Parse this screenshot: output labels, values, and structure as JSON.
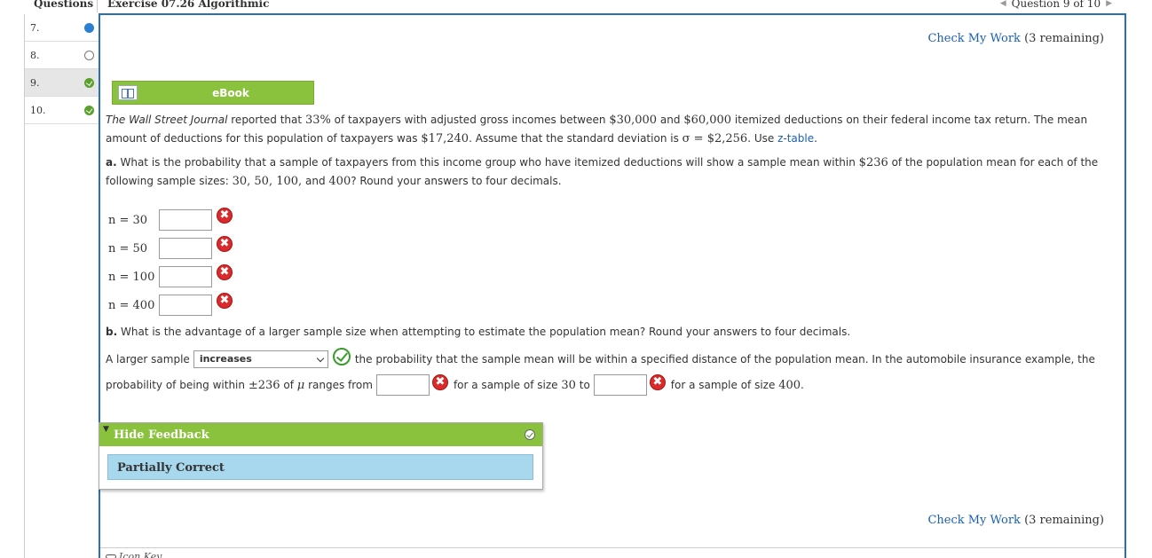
{
  "header": {
    "questions_label": "Questions",
    "exercise_title": "Exercise 07.26 Algorithmic",
    "question_position": "Question 9 of 10",
    "prev_icon": "triangle-left-icon",
    "next_icon": "triangle-right-icon"
  },
  "question_list": [
    {
      "number": "7.",
      "status": "in-progress"
    },
    {
      "number": "8.",
      "status": "not-started"
    },
    {
      "number": "9.",
      "status": "completed"
    },
    {
      "number": "10.",
      "status": "completed"
    }
  ],
  "check_my_work": {
    "label": "Check My Work",
    "remaining": "(3 remaining)"
  },
  "ebook": {
    "label": "eBook",
    "icon": "book-icon"
  },
  "problem": {
    "intro_source": "The Wall Street Journal",
    "intro_text_1": "reported that",
    "percent": "33%",
    "intro_text_2": "of taxpayers with adjusted gross incomes between",
    "income_low": "$30,000",
    "intro_and": "and",
    "income_high": "$60,000",
    "intro_text_3": "itemized deductions on their federal income tax return. The mean amount of deductions for this population of taxpayers was",
    "mean": "$17,240",
    "intro_text_4": ". Assume that the standard deviation is",
    "sigma_expr": "σ = $2,256",
    "intro_text_5": ". Use",
    "ztable_link": "z-table",
    "intro_end": "."
  },
  "part_a": {
    "label": "a.",
    "text_1": "What is the probability that a sample of taxpayers from this income group who have itemized deductions will show a sample mean within",
    "within": "$236",
    "text_2": "of the population mean for each of the following sample sizes:",
    "sizes_text": "30, 50, 100,",
    "and_text": "and",
    "last_size": "400",
    "text_3": "? Round your answers to four decimals.",
    "rows": [
      {
        "label": "n = 30",
        "value": ""
      },
      {
        "label": "n = 50",
        "value": ""
      },
      {
        "label": "n = 100",
        "value": ""
      },
      {
        "label": "n = 400",
        "value": ""
      }
    ],
    "incorrect_mark": "✖"
  },
  "part_b": {
    "label": "b.",
    "question": "What is the advantage of a larger sample size when attempting to estimate the population mean? Round your answers to four decimals.",
    "lead": "A larger sample",
    "selected_option": "increases",
    "after_select": "the probability that the sample mean will be within a specified distance of the population mean. In the automobile insurance example, the",
    "line2_1": "probability of being within",
    "pm_expr": "±236",
    "line2_of": "of",
    "mu": "μ",
    "line2_2": "ranges from",
    "line2_3": "for a sample of size",
    "size_small": "30",
    "line2_to": "to",
    "line2_4": "for a sample of size",
    "size_large": "400",
    "line2_end": ".",
    "range_from_value": "",
    "range_to_value": ""
  },
  "feedback": {
    "toggle_label": "Hide Feedback",
    "result": "Partially Correct"
  },
  "icon_key": {
    "label": "Icon Key"
  },
  "colors": {
    "accent_blue": "#2a6ebb",
    "green_bar": "#8ac23d",
    "incorrect_red": "#d92b2b",
    "correct_green": "#3a9b2c",
    "feedback_blue": "#a8d8ee"
  }
}
